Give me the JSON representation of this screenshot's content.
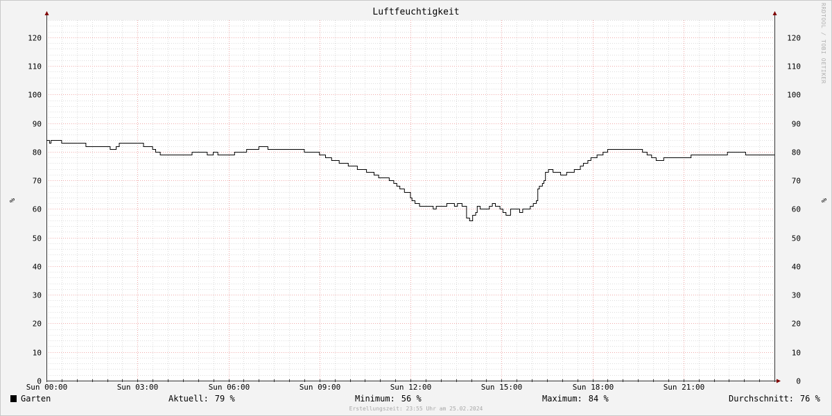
{
  "chart_data": {
    "type": "line",
    "title": "Luftfeuchtigkeit",
    "ylabel": "%",
    "ylim": [
      0,
      126
    ],
    "yticks": [
      0,
      10,
      20,
      30,
      40,
      50,
      60,
      70,
      80,
      90,
      100,
      110,
      120
    ],
    "xlim": [
      0,
      24
    ],
    "xticks": [
      {
        "x": 0,
        "label": "Sun 00:00"
      },
      {
        "x": 3,
        "label": "Sun 03:00"
      },
      {
        "x": 6,
        "label": "Sun 06:00"
      },
      {
        "x": 9,
        "label": "Sun 09:00"
      },
      {
        "x": 12,
        "label": "Sun 12:00"
      },
      {
        "x": 15,
        "label": "Sun 15:00"
      },
      {
        "x": 18,
        "label": "Sun 18:00"
      },
      {
        "x": 21,
        "label": "Sun 21:00"
      }
    ],
    "grid": true,
    "series": [
      {
        "name": "Garten",
        "color": "#000000",
        "step": true,
        "points": [
          [
            0.0,
            84
          ],
          [
            0.1,
            83
          ],
          [
            0.15,
            84
          ],
          [
            0.5,
            83
          ],
          [
            1.3,
            82
          ],
          [
            2.1,
            81
          ],
          [
            2.3,
            82
          ],
          [
            2.4,
            83
          ],
          [
            3.2,
            82
          ],
          [
            3.5,
            81
          ],
          [
            3.6,
            80
          ],
          [
            3.75,
            79
          ],
          [
            4.8,
            80
          ],
          [
            5.3,
            79
          ],
          [
            5.5,
            80
          ],
          [
            5.65,
            79
          ],
          [
            6.2,
            80
          ],
          [
            6.6,
            81
          ],
          [
            7.0,
            82
          ],
          [
            7.3,
            81
          ],
          [
            8.3,
            81
          ],
          [
            8.5,
            80
          ],
          [
            9.0,
            79
          ],
          [
            9.2,
            78
          ],
          [
            9.4,
            77
          ],
          [
            9.65,
            76
          ],
          [
            9.95,
            75
          ],
          [
            10.25,
            74
          ],
          [
            10.55,
            73
          ],
          [
            10.8,
            72
          ],
          [
            10.95,
            71
          ],
          [
            11.3,
            70
          ],
          [
            11.45,
            69
          ],
          [
            11.55,
            68
          ],
          [
            11.65,
            67
          ],
          [
            11.8,
            66
          ],
          [
            12.0,
            64
          ],
          [
            12.05,
            63
          ],
          [
            12.15,
            62
          ],
          [
            12.3,
            61
          ],
          [
            12.75,
            60
          ],
          [
            12.85,
            61
          ],
          [
            13.2,
            62
          ],
          [
            13.45,
            61
          ],
          [
            13.55,
            62
          ],
          [
            13.7,
            61
          ],
          [
            13.85,
            57
          ],
          [
            13.95,
            56
          ],
          [
            14.05,
            58
          ],
          [
            14.15,
            59
          ],
          [
            14.2,
            61
          ],
          [
            14.3,
            60
          ],
          [
            14.6,
            61
          ],
          [
            14.7,
            62
          ],
          [
            14.8,
            61
          ],
          [
            14.95,
            60
          ],
          [
            15.05,
            59
          ],
          [
            15.15,
            58
          ],
          [
            15.3,
            60
          ],
          [
            15.6,
            59
          ],
          [
            15.7,
            60
          ],
          [
            15.95,
            61
          ],
          [
            16.05,
            62
          ],
          [
            16.15,
            63
          ],
          [
            16.2,
            67
          ],
          [
            16.25,
            68
          ],
          [
            16.35,
            69
          ],
          [
            16.4,
            70
          ],
          [
            16.45,
            73
          ],
          [
            16.55,
            74
          ],
          [
            16.7,
            73
          ],
          [
            16.95,
            72
          ],
          [
            17.15,
            73
          ],
          [
            17.4,
            74
          ],
          [
            17.6,
            75
          ],
          [
            17.7,
            76
          ],
          [
            17.85,
            77
          ],
          [
            17.95,
            78
          ],
          [
            18.15,
            79
          ],
          [
            18.35,
            80
          ],
          [
            18.5,
            81
          ],
          [
            19.0,
            81
          ],
          [
            19.55,
            81
          ],
          [
            19.65,
            80
          ],
          [
            19.8,
            79
          ],
          [
            19.95,
            78
          ],
          [
            20.1,
            77
          ],
          [
            20.35,
            78
          ],
          [
            21.25,
            79
          ],
          [
            22.45,
            80
          ],
          [
            23.05,
            79
          ],
          [
            23.95,
            79
          ]
        ]
      }
    ]
  },
  "legend": {
    "series_label": "Garten",
    "current_label": "Aktuell:",
    "current_value": "79 %",
    "min_label": "Minimum:",
    "min_value": "56 %",
    "max_label": "Maximum:",
    "max_value": "84 %",
    "avg_label": "Durchschnitt:",
    "avg_value": "76 %"
  },
  "watermark": "RRDTOOL / TOBI OETIKER",
  "footer": "Erstellungszeit: 23:55 Uhr am 25.02.2024"
}
